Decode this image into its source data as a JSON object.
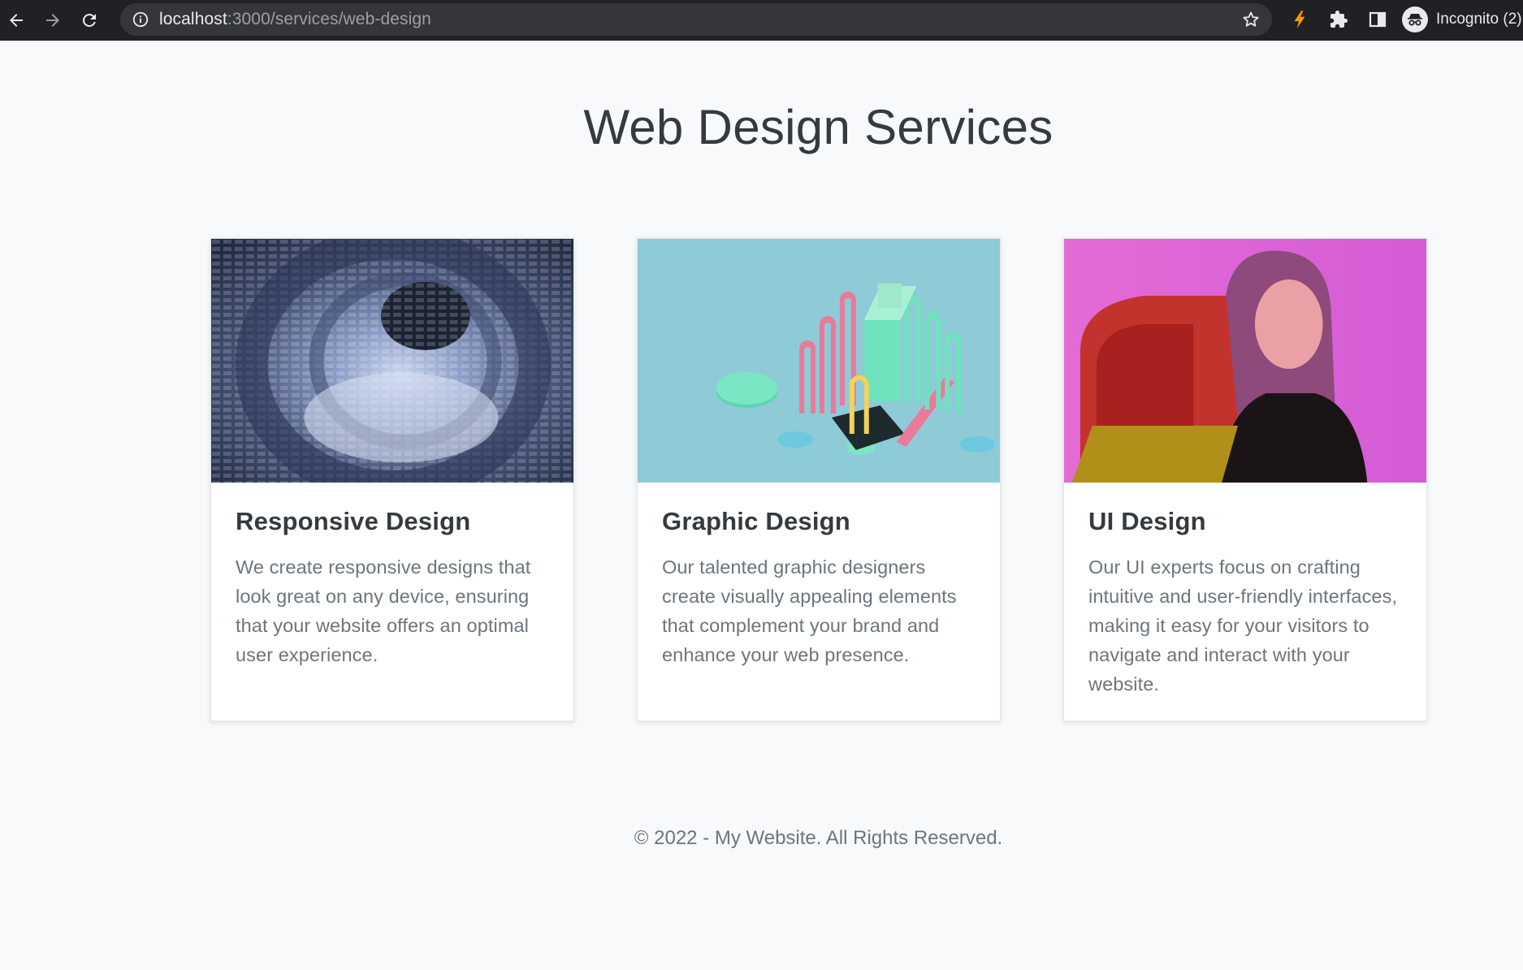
{
  "browser": {
    "url_host": "localhost",
    "url_path": ":3000/services/web-design",
    "profile_label": "Incognito (2)",
    "icons": [
      "back-icon",
      "forward-icon",
      "reload-icon",
      "info-icon",
      "star-icon",
      "lightning-extension-icon",
      "puzzle-extension-icon",
      "side-panel-icon",
      "incognito-icon"
    ]
  },
  "page": {
    "title": "Web Design Services",
    "cards": [
      {
        "title": "Responsive Design",
        "text": "We create responsive designs that look great on any device, ensuring that your website offers an optimal user experience."
      },
      {
        "title": "Graphic Design",
        "text": "Our talented graphic designers create visually appealing elements that complement your brand and enhance your web presence."
      },
      {
        "title": "UI Design",
        "text": "Our UI experts focus on crafting intuitive and user-friendly interfaces, making it easy for your visitors to navigate and interact with your website."
      }
    ],
    "footer": "© 2022 - My Website. All Rights Reserved."
  },
  "colors": {
    "chrome_bg": "#202124",
    "omnibox_bg": "#35363a",
    "page_bg": "#f8f9fa",
    "heading": "#343a40",
    "body_text": "#6c757d",
    "lightning_accent": "#f29900"
  }
}
